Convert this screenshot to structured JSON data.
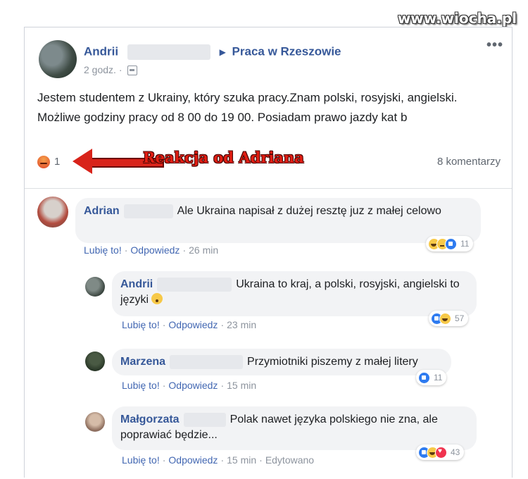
{
  "watermark": "www.wiocha.pl",
  "post": {
    "author": "Andrii",
    "group": "Praca w Rzeszowie",
    "time": "2 godz.",
    "text": "Jestem studentem z Ukrainy, który szuka pracy.Znam polski, rosyjski, angielski. Możliwe godziny pracy od 8 00 do 19 00. Posiadam prawo jazdy kat b",
    "reaction_count": "1",
    "comments_count": "8 komentarzy",
    "annotation": "Reakcja od Adriana",
    "more": "•••"
  },
  "icons": {
    "post_reaction": "angry-icon",
    "visibility": "group-icon",
    "arrow": "red-arrow"
  },
  "colors": {
    "link": "#365899",
    "annotation": "#e11d12",
    "bubble": "#f2f3f5"
  },
  "comments": [
    {
      "name": "Adrian",
      "text": "Ale Ukraina napisał z dużej resztę juz z małej celowo",
      "like": "Lubię to!",
      "reply": "Odpowiedz",
      "time": "26 min",
      "reactions": [
        "haha",
        "sad",
        "like"
      ],
      "reaction_count": "11"
    },
    {
      "name": "Andrii",
      "text": "Ukraina to kraj, a polski, rosyjski, angielski to języki",
      "like": "Lubię to!",
      "reply": "Odpowiedz",
      "time": "23 min",
      "reactions": [
        "like",
        "haha"
      ],
      "reaction_count": "57"
    },
    {
      "name": "Marzena",
      "text": "Przymiotniki piszemy z małej litery",
      "like": "Lubię to!",
      "reply": "Odpowiedz",
      "time": "15 min",
      "reactions": [
        "like"
      ],
      "reaction_count": "11"
    },
    {
      "name": "Małgorzata",
      "text": "Polak nawet języka polskiego nie zna, ale poprawiać będzie...",
      "like": "Lubię to!",
      "reply": "Odpowiedz",
      "time": "15 min",
      "edited": "Edytowano",
      "reactions": [
        "like",
        "haha",
        "love"
      ],
      "reaction_count": "43"
    }
  ]
}
